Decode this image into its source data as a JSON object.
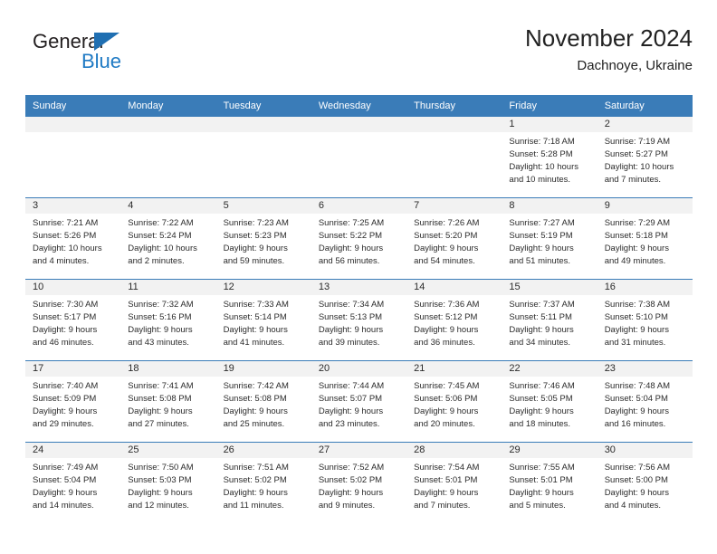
{
  "brand": {
    "name_part1": "General",
    "name_part2": "Blue",
    "logo_icon": "triangle-icon"
  },
  "header": {
    "title": "November 2024",
    "subtitle": "Dachnoye, Ukraine"
  },
  "colors": {
    "header_blue": "#3a7cb8",
    "date_strip_gray": "#f2f2f2",
    "brand_blue": "#1f7ac4",
    "text": "#2b2b2b"
  },
  "weekdays": [
    "Sunday",
    "Monday",
    "Tuesday",
    "Wednesday",
    "Thursday",
    "Friday",
    "Saturday"
  ],
  "weeks": [
    [
      {
        "day": "",
        "empty": true
      },
      {
        "day": "",
        "empty": true
      },
      {
        "day": "",
        "empty": true
      },
      {
        "day": "",
        "empty": true
      },
      {
        "day": "",
        "empty": true
      },
      {
        "day": "1",
        "sunrise": "Sunrise: 7:18 AM",
        "sunset": "Sunset: 5:28 PM",
        "daylight_line1": "Daylight: 10 hours",
        "daylight_line2": "and 10 minutes."
      },
      {
        "day": "2",
        "sunrise": "Sunrise: 7:19 AM",
        "sunset": "Sunset: 5:27 PM",
        "daylight_line1": "Daylight: 10 hours",
        "daylight_line2": "and 7 minutes."
      }
    ],
    [
      {
        "day": "3",
        "sunrise": "Sunrise: 7:21 AM",
        "sunset": "Sunset: 5:26 PM",
        "daylight_line1": "Daylight: 10 hours",
        "daylight_line2": "and 4 minutes."
      },
      {
        "day": "4",
        "sunrise": "Sunrise: 7:22 AM",
        "sunset": "Sunset: 5:24 PM",
        "daylight_line1": "Daylight: 10 hours",
        "daylight_line2": "and 2 minutes."
      },
      {
        "day": "5",
        "sunrise": "Sunrise: 7:23 AM",
        "sunset": "Sunset: 5:23 PM",
        "daylight_line1": "Daylight: 9 hours",
        "daylight_line2": "and 59 minutes."
      },
      {
        "day": "6",
        "sunrise": "Sunrise: 7:25 AM",
        "sunset": "Sunset: 5:22 PM",
        "daylight_line1": "Daylight: 9 hours",
        "daylight_line2": "and 56 minutes."
      },
      {
        "day": "7",
        "sunrise": "Sunrise: 7:26 AM",
        "sunset": "Sunset: 5:20 PM",
        "daylight_line1": "Daylight: 9 hours",
        "daylight_line2": "and 54 minutes."
      },
      {
        "day": "8",
        "sunrise": "Sunrise: 7:27 AM",
        "sunset": "Sunset: 5:19 PM",
        "daylight_line1": "Daylight: 9 hours",
        "daylight_line2": "and 51 minutes."
      },
      {
        "day": "9",
        "sunrise": "Sunrise: 7:29 AM",
        "sunset": "Sunset: 5:18 PM",
        "daylight_line1": "Daylight: 9 hours",
        "daylight_line2": "and 49 minutes."
      }
    ],
    [
      {
        "day": "10",
        "sunrise": "Sunrise: 7:30 AM",
        "sunset": "Sunset: 5:17 PM",
        "daylight_line1": "Daylight: 9 hours",
        "daylight_line2": "and 46 minutes."
      },
      {
        "day": "11",
        "sunrise": "Sunrise: 7:32 AM",
        "sunset": "Sunset: 5:16 PM",
        "daylight_line1": "Daylight: 9 hours",
        "daylight_line2": "and 43 minutes."
      },
      {
        "day": "12",
        "sunrise": "Sunrise: 7:33 AM",
        "sunset": "Sunset: 5:14 PM",
        "daylight_line1": "Daylight: 9 hours",
        "daylight_line2": "and 41 minutes."
      },
      {
        "day": "13",
        "sunrise": "Sunrise: 7:34 AM",
        "sunset": "Sunset: 5:13 PM",
        "daylight_line1": "Daylight: 9 hours",
        "daylight_line2": "and 39 minutes."
      },
      {
        "day": "14",
        "sunrise": "Sunrise: 7:36 AM",
        "sunset": "Sunset: 5:12 PM",
        "daylight_line1": "Daylight: 9 hours",
        "daylight_line2": "and 36 minutes."
      },
      {
        "day": "15",
        "sunrise": "Sunrise: 7:37 AM",
        "sunset": "Sunset: 5:11 PM",
        "daylight_line1": "Daylight: 9 hours",
        "daylight_line2": "and 34 minutes."
      },
      {
        "day": "16",
        "sunrise": "Sunrise: 7:38 AM",
        "sunset": "Sunset: 5:10 PM",
        "daylight_line1": "Daylight: 9 hours",
        "daylight_line2": "and 31 minutes."
      }
    ],
    [
      {
        "day": "17",
        "sunrise": "Sunrise: 7:40 AM",
        "sunset": "Sunset: 5:09 PM",
        "daylight_line1": "Daylight: 9 hours",
        "daylight_line2": "and 29 minutes."
      },
      {
        "day": "18",
        "sunrise": "Sunrise: 7:41 AM",
        "sunset": "Sunset: 5:08 PM",
        "daylight_line1": "Daylight: 9 hours",
        "daylight_line2": "and 27 minutes."
      },
      {
        "day": "19",
        "sunrise": "Sunrise: 7:42 AM",
        "sunset": "Sunset: 5:08 PM",
        "daylight_line1": "Daylight: 9 hours",
        "daylight_line2": "and 25 minutes."
      },
      {
        "day": "20",
        "sunrise": "Sunrise: 7:44 AM",
        "sunset": "Sunset: 5:07 PM",
        "daylight_line1": "Daylight: 9 hours",
        "daylight_line2": "and 23 minutes."
      },
      {
        "day": "21",
        "sunrise": "Sunrise: 7:45 AM",
        "sunset": "Sunset: 5:06 PM",
        "daylight_line1": "Daylight: 9 hours",
        "daylight_line2": "and 20 minutes."
      },
      {
        "day": "22",
        "sunrise": "Sunrise: 7:46 AM",
        "sunset": "Sunset: 5:05 PM",
        "daylight_line1": "Daylight: 9 hours",
        "daylight_line2": "and 18 minutes."
      },
      {
        "day": "23",
        "sunrise": "Sunrise: 7:48 AM",
        "sunset": "Sunset: 5:04 PM",
        "daylight_line1": "Daylight: 9 hours",
        "daylight_line2": "and 16 minutes."
      }
    ],
    [
      {
        "day": "24",
        "sunrise": "Sunrise: 7:49 AM",
        "sunset": "Sunset: 5:04 PM",
        "daylight_line1": "Daylight: 9 hours",
        "daylight_line2": "and 14 minutes."
      },
      {
        "day": "25",
        "sunrise": "Sunrise: 7:50 AM",
        "sunset": "Sunset: 5:03 PM",
        "daylight_line1": "Daylight: 9 hours",
        "daylight_line2": "and 12 minutes."
      },
      {
        "day": "26",
        "sunrise": "Sunrise: 7:51 AM",
        "sunset": "Sunset: 5:02 PM",
        "daylight_line1": "Daylight: 9 hours",
        "daylight_line2": "and 11 minutes."
      },
      {
        "day": "27",
        "sunrise": "Sunrise: 7:52 AM",
        "sunset": "Sunset: 5:02 PM",
        "daylight_line1": "Daylight: 9 hours",
        "daylight_line2": "and 9 minutes."
      },
      {
        "day": "28",
        "sunrise": "Sunrise: 7:54 AM",
        "sunset": "Sunset: 5:01 PM",
        "daylight_line1": "Daylight: 9 hours",
        "daylight_line2": "and 7 minutes."
      },
      {
        "day": "29",
        "sunrise": "Sunrise: 7:55 AM",
        "sunset": "Sunset: 5:01 PM",
        "daylight_line1": "Daylight: 9 hours",
        "daylight_line2": "and 5 minutes."
      },
      {
        "day": "30",
        "sunrise": "Sunrise: 7:56 AM",
        "sunset": "Sunset: 5:00 PM",
        "daylight_line1": "Daylight: 9 hours",
        "daylight_line2": "and 4 minutes."
      }
    ]
  ]
}
